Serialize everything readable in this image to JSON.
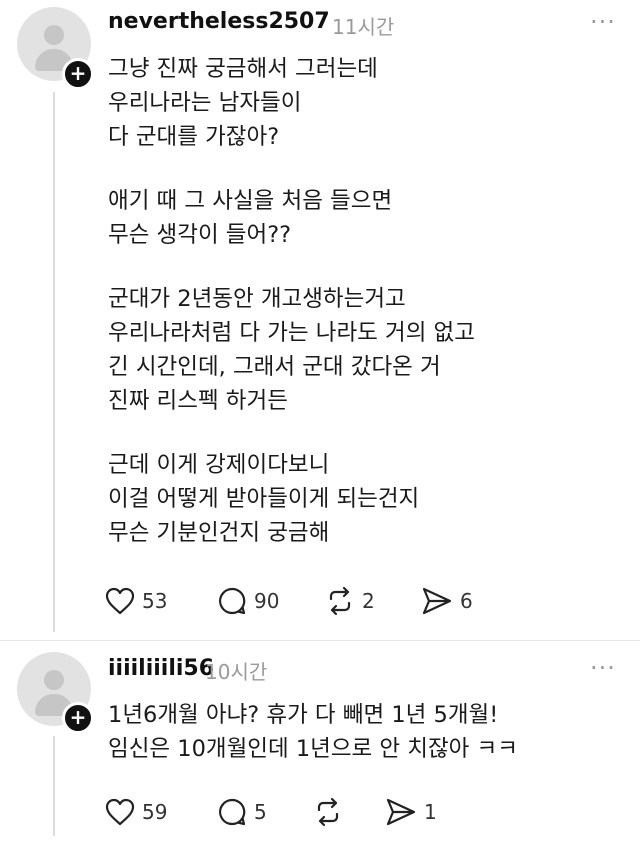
{
  "posts": [
    {
      "username": "nevertheless2507",
      "time": "11시간",
      "more": "···",
      "paragraphs": [
        "그냥 진짜 궁금해서 그러는데\n우리나라는 남자들이\n다 군대를 가잖아?",
        "애기 때 그 사실을 처음 들으면\n무슨 생각이 들어??",
        "군대가 2년동안 개고생하는거고\n우리나라처럼 다 가는 나라도 거의 없고\n긴 시간인데, 그래서 군대 갔다온 거\n진짜 리스펙 하거든",
        "근데 이게 강제이다보니\n이걸 어떻게 받아들이게 되는건지\n무슨 기분인건지 궁금해"
      ],
      "likes": "53",
      "comments": "90",
      "reposts": "2",
      "shares": "6"
    },
    {
      "username": "iiiiliiili56",
      "time": "10시간",
      "more": "···",
      "paragraphs": [
        "1년6개월 아냐? 휴가 다 빼면 1년 5개월!\n임신은 10개월인데 1년으로 안 치잖아 ㅋㅋ"
      ],
      "likes": "59",
      "comments": "5",
      "reposts": "",
      "shares": "1"
    }
  ],
  "icons": {
    "avatar": "default-profile-icon",
    "add": "plus-icon",
    "like": "heart-icon",
    "comment": "speech-bubble-icon",
    "repost": "repost-arrows-icon",
    "share": "send-arrow-icon"
  }
}
